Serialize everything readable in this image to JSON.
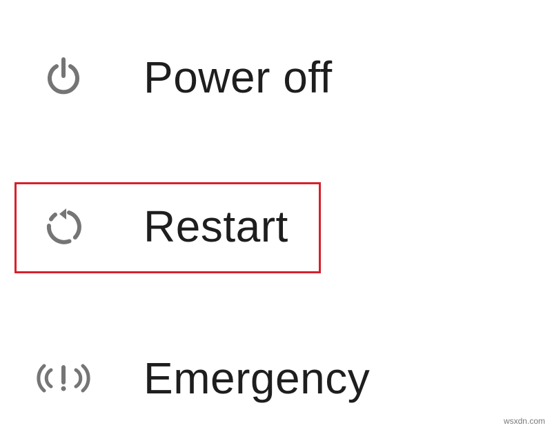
{
  "menu": {
    "items": [
      {
        "id": "power-off",
        "label": "Power off",
        "icon": "power-icon"
      },
      {
        "id": "restart",
        "label": "Restart",
        "icon": "restart-icon"
      },
      {
        "id": "emergency",
        "label": "Emergency",
        "icon": "emergency-icon"
      }
    ],
    "highlighted": "restart"
  },
  "colors": {
    "icon": "#757575",
    "text": "#1e1e1e",
    "highlight": "#d7202c",
    "background": "#ffffff"
  },
  "watermark": "wsxdn.com"
}
